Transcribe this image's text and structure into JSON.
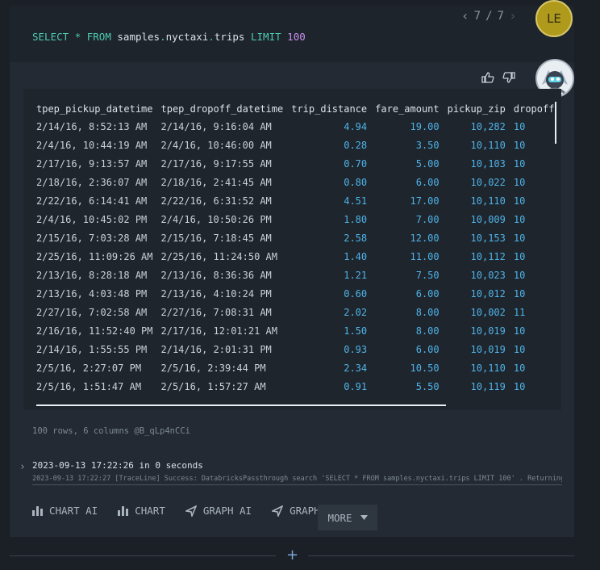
{
  "query": {
    "select_kw": "SELECT",
    "star": "*",
    "from_kw": "FROM",
    "schema": "samples",
    "dot1": ".",
    "db": "nyctaxi",
    "dot2": ".",
    "table": "trips",
    "limit_kw": "LIMIT",
    "limit_val": "100"
  },
  "pager": {
    "current": "7",
    "sep": "/",
    "total": "7"
  },
  "user_avatar": {
    "initials": "LE"
  },
  "table": {
    "columns": [
      "tpep_pickup_datetime",
      "tpep_dropoff_datetime",
      "trip_distance",
      "fare_amount",
      "pickup_zip",
      "dropoff"
    ],
    "rows": [
      [
        "2/14/16, 8:52:13 AM",
        "2/14/16, 9:16:04 AM",
        "4.94",
        "19.00",
        "10,282",
        "10"
      ],
      [
        "2/4/16, 10:44:19 AM",
        "2/4/16, 10:46:00 AM",
        "0.28",
        "3.50",
        "10,110",
        "10"
      ],
      [
        "2/17/16, 9:13:57 AM",
        "2/17/16, 9:17:55 AM",
        "0.70",
        "5.00",
        "10,103",
        "10"
      ],
      [
        "2/18/16, 2:36:07 AM",
        "2/18/16, 2:41:45 AM",
        "0.80",
        "6.00",
        "10,022",
        "10"
      ],
      [
        "2/22/16, 6:14:41 AM",
        "2/22/16, 6:31:52 AM",
        "4.51",
        "17.00",
        "10,110",
        "10"
      ],
      [
        "2/4/16, 10:45:02 PM",
        "2/4/16, 10:50:26 PM",
        "1.80",
        "7.00",
        "10,009",
        "10"
      ],
      [
        "2/15/16, 7:03:28 AM",
        "2/15/16, 7:18:45 AM",
        "2.58",
        "12.00",
        "10,153",
        "10"
      ],
      [
        "2/25/16, 11:09:26 AM",
        "2/25/16, 11:24:50 AM",
        "1.40",
        "11.00",
        "10,112",
        "10"
      ],
      [
        "2/13/16, 8:28:18 AM",
        "2/13/16, 8:36:36 AM",
        "1.21",
        "7.50",
        "10,023",
        "10"
      ],
      [
        "2/13/16, 4:03:48 PM",
        "2/13/16, 4:10:24 PM",
        "0.60",
        "6.00",
        "10,012",
        "10"
      ],
      [
        "2/27/16, 7:02:58 AM",
        "2/27/16, 7:08:31 AM",
        "2.02",
        "8.00",
        "10,002",
        "11"
      ],
      [
        "2/16/16, 11:52:40 PM",
        "2/17/16, 12:01:21 AM",
        "1.50",
        "8.00",
        "10,019",
        "10"
      ],
      [
        "2/14/16, 1:55:55 PM",
        "2/14/16, 2:01:31 PM",
        "0.93",
        "6.00",
        "10,019",
        "10"
      ],
      [
        "2/5/16, 2:27:07 PM",
        "2/5/16, 2:39:44 PM",
        "2.34",
        "10.50",
        "10,110",
        "10"
      ],
      [
        "2/5/16, 1:51:47 AM",
        "2/5/16, 1:57:27 AM",
        "0.91",
        "5.50",
        "10,119",
        "10"
      ]
    ]
  },
  "row_info": "100 rows, 6 columns @B_qLp4nCCi",
  "trace": {
    "timestamp_line": "2023-09-13 17:22:26 in 0 seconds",
    "log_line": "2023-09-13 17:22:27 [TraceLine] Success: DatabricksPassthrough search 'SELECT * FROM samples.nyctaxi.trips LIMIT 100' . Returning da"
  },
  "toolbar": {
    "chart_ai": "CHART AI",
    "chart": "CHART",
    "graph_ai": "GRAPH AI",
    "graph": "GRAPH",
    "more": "MORE"
  },
  "add_symbol": "+",
  "icons": {
    "pager_prev": "chevron-left-icon",
    "pager_next": "chevron-right-icon",
    "thumb_up": "thumbs-up-icon",
    "thumb_down": "thumbs-down-icon",
    "chart": "bar-chart-icon",
    "graph": "graph-icon",
    "more": "caret-down-icon",
    "trace": "chevron-right-icon"
  },
  "colors": {
    "keyword": "#4ec9b0",
    "number_literal": "#c98ef0",
    "numeric_cell": "#4fb3e8",
    "avatar_bg": "#b09a1c"
  }
}
